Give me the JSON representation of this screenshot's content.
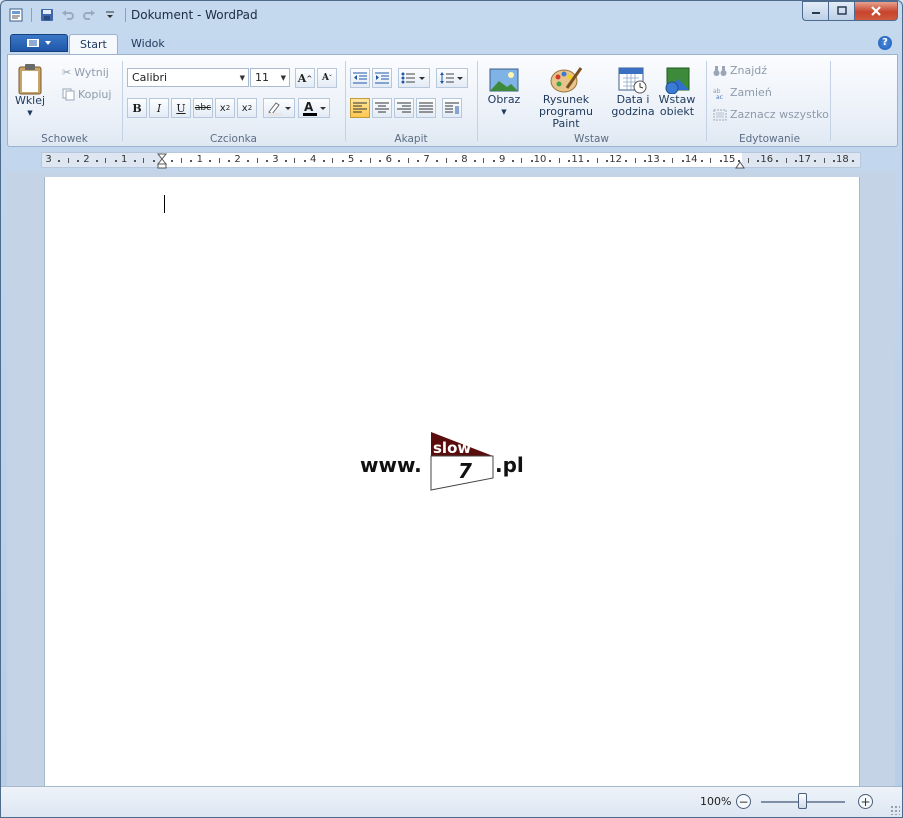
{
  "window": {
    "title": "Dokument - WordPad"
  },
  "tabs": {
    "start": "Start",
    "view": "Widok"
  },
  "clipboard": {
    "group_label": "Schowek",
    "paste": "Wklej",
    "cut": "Wytnij",
    "copy": "Kopiuj"
  },
  "font": {
    "group_label": "Czcionka",
    "family": "Calibri",
    "size": "11"
  },
  "paragraph": {
    "group_label": "Akapit"
  },
  "insert": {
    "group_label": "Wstaw",
    "picture": "Obraz",
    "paint_line1": "Rysunek",
    "paint_line2": "programu Paint",
    "datetime_line1": "Data i",
    "datetime_line2": "godzina",
    "object_line1": "Wstaw",
    "object_line2": "obiekt"
  },
  "editing": {
    "group_label": "Edytowanie",
    "find": "Znajdź",
    "replace": "Zamień",
    "select_all": "Zaznacz wszystko"
  },
  "ruler": {
    "labels": [
      "3",
      "2",
      "1",
      "1",
      "2",
      "3",
      "4",
      "5",
      "6",
      "7",
      "8",
      "9",
      "10",
      "11",
      "12",
      "13",
      "14",
      "15",
      "16",
      "17",
      "18"
    ]
  },
  "logo": {
    "prefix": "www.",
    "banner": "slow",
    "number": "7",
    "suffix": ".pl"
  },
  "status": {
    "zoom": "100%"
  },
  "colors": {
    "accent": "#1f56a8",
    "ribbon_bg": "#eaf0f8",
    "logo_banner": "#5a0d0d"
  }
}
